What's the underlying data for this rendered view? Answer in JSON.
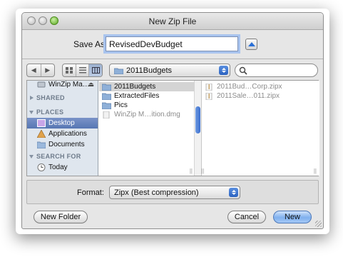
{
  "window": {
    "title": "New Zip File"
  },
  "save_as": {
    "label": "Save As:",
    "value": "RevisedDevBudget"
  },
  "toolbar": {
    "back_icon": "back-arrow-icon",
    "forward_icon": "forward-arrow-icon",
    "views": [
      "icon-view",
      "list-view",
      "column-view"
    ],
    "location": "2011Budgets",
    "search_value": ""
  },
  "sidebar": {
    "items_top": [
      {
        "label": "WinZip Ma…",
        "icon": "disk-icon"
      }
    ],
    "shared": "SHARED",
    "places": "PLACES",
    "places_items": [
      {
        "label": "Desktop",
        "icon": "desktop-icon",
        "selected": true
      },
      {
        "label": "Applications",
        "icon": "applications-icon"
      },
      {
        "label": "Documents",
        "icon": "documents-icon"
      }
    ],
    "search_for": "SEARCH FOR",
    "search_items": [
      {
        "label": "Today",
        "icon": "clock-icon"
      }
    ]
  },
  "column1": [
    {
      "label": "2011Budgets",
      "type": "folder",
      "selected": true,
      "has_children": true
    },
    {
      "label": "ExtractedFiles",
      "type": "folder",
      "has_children": true
    },
    {
      "label": "Pics",
      "type": "folder",
      "has_children": true
    },
    {
      "label": "WinZip M…ition.dmg",
      "type": "file",
      "dim": true
    }
  ],
  "column2": [
    {
      "label": "2011Bud…Corp.zipx",
      "type": "zipx"
    },
    {
      "label": "2011Sale…011.zipx",
      "type": "zipx"
    }
  ],
  "format": {
    "label": "Format:",
    "value": "Zipx (Best compression)"
  },
  "buttons": {
    "new_folder": "New Folder",
    "cancel": "Cancel",
    "new": "New"
  },
  "colors": {
    "accent": "#3b6fcf",
    "selection": "#5676b3",
    "focus_ring": "#a9c4ee"
  }
}
